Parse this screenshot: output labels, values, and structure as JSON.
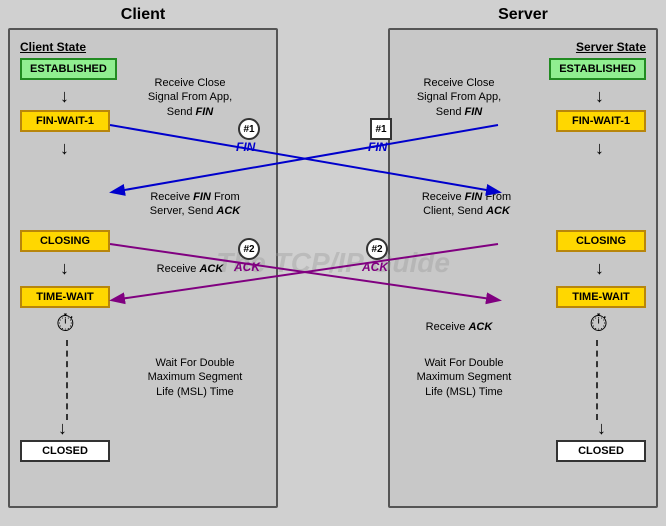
{
  "title": {
    "client": "Client",
    "server": "Server"
  },
  "client": {
    "state_section": "Client State",
    "states": [
      {
        "id": "established",
        "label": "ESTABLISHED",
        "type": "established"
      },
      {
        "id": "fin-wait-1",
        "label": "FIN-WAIT-1",
        "type": "fin-wait"
      },
      {
        "id": "closing",
        "label": "CLOSING",
        "type": "closing"
      },
      {
        "id": "time-wait",
        "label": "TIME-WAIT",
        "type": "time-wait"
      },
      {
        "id": "closed",
        "label": "CLOSED",
        "type": "closed"
      }
    ],
    "descriptions": [
      {
        "id": "desc1",
        "text": "Receive Close Signal From App, Send FIN"
      },
      {
        "id": "desc2",
        "text": "Receive FIN From Server, Send ACK"
      },
      {
        "id": "desc3",
        "text": "Receive ACK"
      },
      {
        "id": "desc4",
        "text": "Wait For Double Maximum Segment Life (MSL) Time"
      }
    ]
  },
  "server": {
    "state_section": "Server State",
    "states": [
      {
        "id": "established",
        "label": "ESTABLISHED",
        "type": "established"
      },
      {
        "id": "fin-wait-1",
        "label": "FIN-WAIT-1",
        "type": "fin-wait"
      },
      {
        "id": "closing",
        "label": "CLOSING",
        "type": "closing"
      },
      {
        "id": "time-wait",
        "label": "TIME-WAIT",
        "type": "time-wait"
      },
      {
        "id": "closed",
        "label": "CLOSED",
        "type": "closed"
      }
    ],
    "descriptions": [
      {
        "id": "desc1",
        "text": "Receive Close Signal From App, Send FIN"
      },
      {
        "id": "desc2",
        "text": "Receive FIN From Client, Send ACK"
      },
      {
        "id": "desc3",
        "text": "Receive ACK"
      },
      {
        "id": "desc4",
        "text": "Wait For Double Maximum Segment Life (MSL) Time"
      }
    ]
  },
  "messages": [
    {
      "id": "fin1-client",
      "label": "#1",
      "sublabel": "FIN",
      "color": "#0000cc"
    },
    {
      "id": "fin1-server",
      "label": "#1",
      "sublabel": "FIN",
      "color": "#0000cc"
    },
    {
      "id": "ack2-server",
      "label": "#2",
      "sublabel": "ACK",
      "color": "#800080"
    },
    {
      "id": "ack2-client",
      "label": "#2",
      "sublabel": "ACK",
      "color": "#800080"
    }
  ],
  "watermark": "The TCP/IP Guide"
}
